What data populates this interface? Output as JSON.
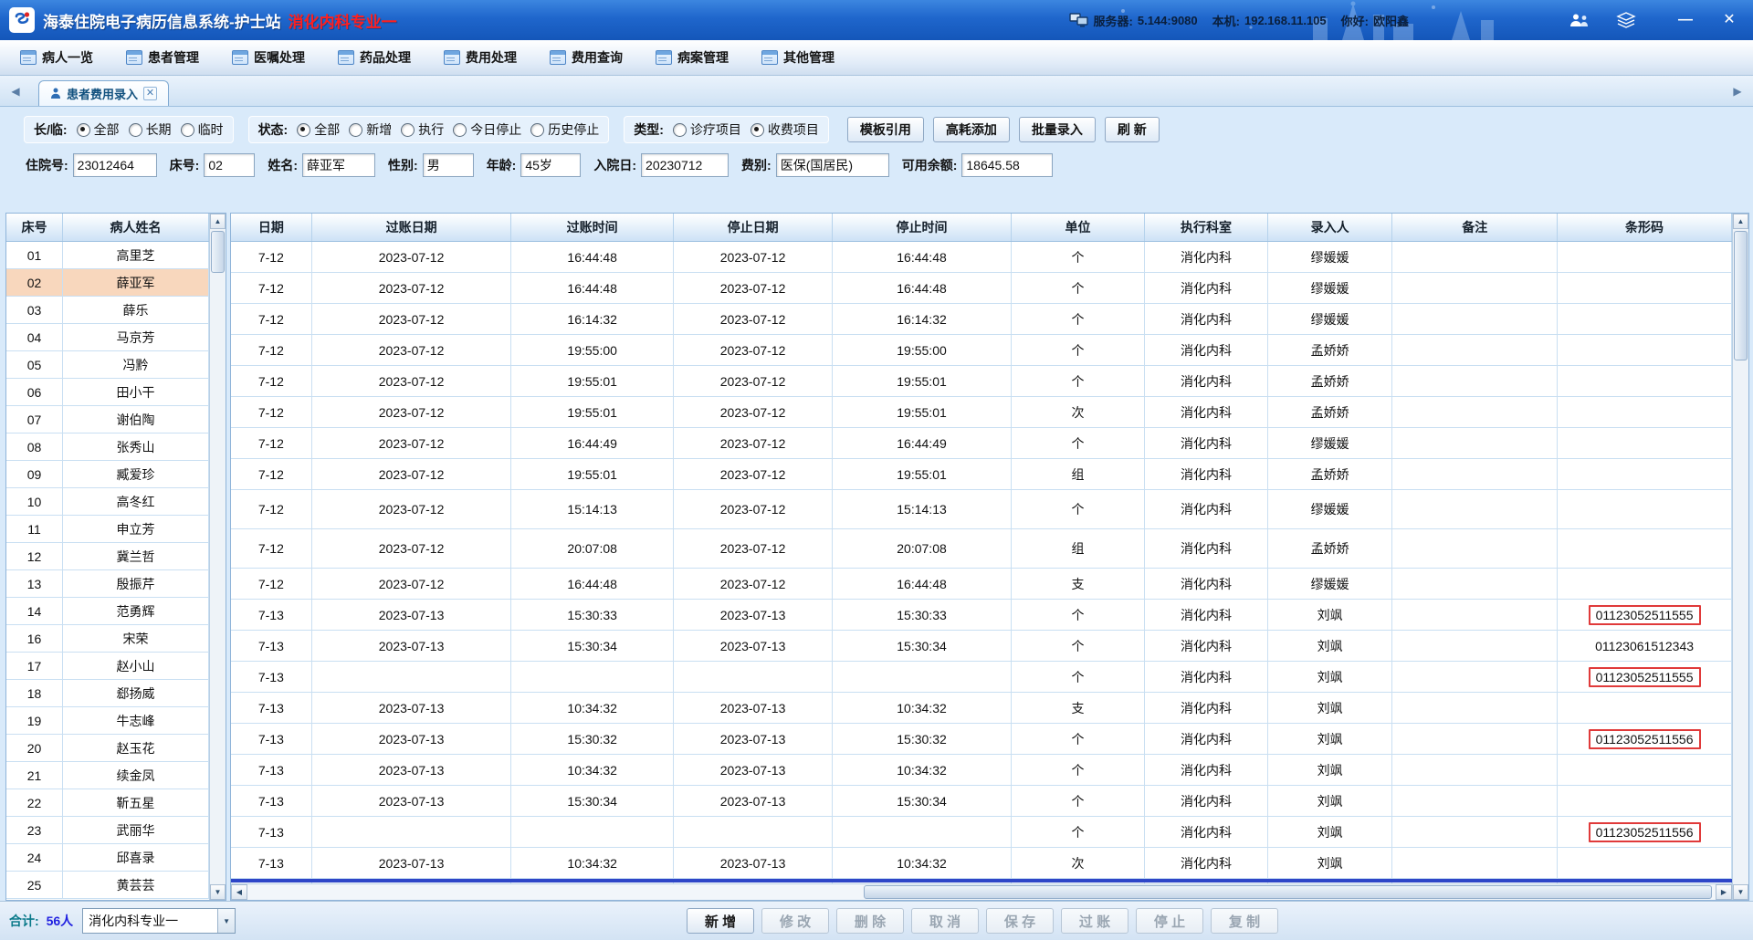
{
  "titlebar": {
    "title": "海泰住院电子病历信息系统-护士站",
    "department": "消化内科专业一",
    "server_label": "服务器:",
    "server_value": "5.144:9080",
    "host_label": "本机:",
    "host_value": "192.168.11.105",
    "greeting_label": "你好:",
    "user_name": "欧阳鑫",
    "minimize_glyph": "—",
    "close_glyph": "✕"
  },
  "menubar": {
    "items": [
      {
        "label": "病人一览"
      },
      {
        "label": "患者管理"
      },
      {
        "label": "医嘱处理"
      },
      {
        "label": "药品处理"
      },
      {
        "label": "费用处理"
      },
      {
        "label": "费用查询"
      },
      {
        "label": "病案管理"
      },
      {
        "label": "其他管理"
      }
    ]
  },
  "tabbar": {
    "active_tab": "患者费用录入",
    "close_glyph": "✕",
    "left_arrow": "◀",
    "right_arrow": "▶"
  },
  "filters": {
    "duration": {
      "label": "长/临:",
      "options": [
        {
          "label": "全部",
          "checked": true
        },
        {
          "label": "长期",
          "checked": false
        },
        {
          "label": "临时",
          "checked": false
        }
      ]
    },
    "status": {
      "label": "状态:",
      "options": [
        {
          "label": "全部",
          "checked": true
        },
        {
          "label": "新增",
          "checked": false
        },
        {
          "label": "执行",
          "checked": false
        },
        {
          "label": "今日停止",
          "checked": false
        },
        {
          "label": "历史停止",
          "checked": false
        }
      ]
    },
    "type": {
      "label": "类型:",
      "options": [
        {
          "label": "诊疗项目",
          "checked": false
        },
        {
          "label": "收费项目",
          "checked": true
        }
      ]
    },
    "buttons": [
      {
        "label": "模板引用"
      },
      {
        "label": "高耗添加"
      },
      {
        "label": "批量录入"
      },
      {
        "label": "刷 新"
      }
    ]
  },
  "patient_info": {
    "fields": [
      {
        "label": "住院号:",
        "value": "23012464"
      },
      {
        "label": "床号:",
        "value": "02"
      },
      {
        "label": "姓名:",
        "value": "薛亚军"
      },
      {
        "label": "性别:",
        "value": "男"
      },
      {
        "label": "年龄:",
        "value": "45岁"
      },
      {
        "label": "入院日:",
        "value": "20230712"
      },
      {
        "label": "费别:",
        "value": "医保(国居民)"
      },
      {
        "label": "可用余额:",
        "value": "18645.58"
      }
    ]
  },
  "patient_list": {
    "headers": {
      "bed": "床号",
      "name": "病人姓名"
    },
    "rows": [
      {
        "bed": "01",
        "name": "高里芝",
        "selected": false
      },
      {
        "bed": "02",
        "name": "薛亚军",
        "selected": true
      },
      {
        "bed": "03",
        "name": "薛乐",
        "selected": false
      },
      {
        "bed": "04",
        "name": "马京芳",
        "selected": false
      },
      {
        "bed": "05",
        "name": "冯黔",
        "selected": false
      },
      {
        "bed": "06",
        "name": "田小干",
        "selected": false
      },
      {
        "bed": "07",
        "name": "谢伯陶",
        "selected": false
      },
      {
        "bed": "08",
        "name": "张秀山",
        "selected": false
      },
      {
        "bed": "09",
        "name": "臧爱珍",
        "selected": false
      },
      {
        "bed": "10",
        "name": "高冬红",
        "selected": false
      },
      {
        "bed": "11",
        "name": "申立芳",
        "selected": false
      },
      {
        "bed": "12",
        "name": "冀兰哲",
        "selected": false
      },
      {
        "bed": "13",
        "name": "殷振芹",
        "selected": false
      },
      {
        "bed": "14",
        "name": "范勇辉",
        "selected": false
      },
      {
        "bed": "16",
        "name": "宋荣",
        "selected": false
      },
      {
        "bed": "17",
        "name": "赵小山",
        "selected": false
      },
      {
        "bed": "18",
        "name": "郄扬威",
        "selected": false
      },
      {
        "bed": "19",
        "name": "牛志峰",
        "selected": false
      },
      {
        "bed": "20",
        "name": "赵玉花",
        "selected": false
      },
      {
        "bed": "21",
        "name": "续金凤",
        "selected": false
      },
      {
        "bed": "22",
        "name": "靳五星",
        "selected": false
      },
      {
        "bed": "23",
        "name": "武丽华",
        "selected": false
      },
      {
        "bed": "24",
        "name": "邱喜录",
        "selected": false
      },
      {
        "bed": "25",
        "name": "黄芸芸",
        "selected": false
      }
    ]
  },
  "fee_table": {
    "headers": [
      "日期",
      "过账日期",
      "过账时间",
      "停止日期",
      "停止时间",
      "单位",
      "执行科室",
      "录入人",
      "备注",
      "条形码"
    ],
    "rows": [
      {
        "date": "7-12",
        "post_date": "2023-07-12",
        "post_time": "16:44:48",
        "stop_date": "2023-07-12",
        "stop_time": "16:44:48",
        "unit": "个",
        "dept": "消化内科",
        "operator": "缪媛媛",
        "note": "",
        "barcode": "",
        "barcode_boxed": false,
        "tall": false
      },
      {
        "date": "7-12",
        "post_date": "2023-07-12",
        "post_time": "16:44:48",
        "stop_date": "2023-07-12",
        "stop_time": "16:44:48",
        "unit": "个",
        "dept": "消化内科",
        "operator": "缪媛媛",
        "note": "",
        "barcode": "",
        "barcode_boxed": false,
        "tall": false
      },
      {
        "date": "7-12",
        "post_date": "2023-07-12",
        "post_time": "16:14:32",
        "stop_date": "2023-07-12",
        "stop_time": "16:14:32",
        "unit": "个",
        "dept": "消化内科",
        "operator": "缪媛媛",
        "note": "",
        "barcode": "",
        "barcode_boxed": false,
        "tall": false
      },
      {
        "date": "7-12",
        "post_date": "2023-07-12",
        "post_time": "19:55:00",
        "stop_date": "2023-07-12",
        "stop_time": "19:55:00",
        "unit": "个",
        "dept": "消化内科",
        "operator": "孟娇娇",
        "note": "",
        "barcode": "",
        "barcode_boxed": false,
        "tall": false
      },
      {
        "date": "7-12",
        "post_date": "2023-07-12",
        "post_time": "19:55:01",
        "stop_date": "2023-07-12",
        "stop_time": "19:55:01",
        "unit": "个",
        "dept": "消化内科",
        "operator": "孟娇娇",
        "note": "",
        "barcode": "",
        "barcode_boxed": false,
        "tall": false
      },
      {
        "date": "7-12",
        "post_date": "2023-07-12",
        "post_time": "19:55:01",
        "stop_date": "2023-07-12",
        "stop_time": "19:55:01",
        "unit": "次",
        "dept": "消化内科",
        "operator": "孟娇娇",
        "note": "",
        "barcode": "",
        "barcode_boxed": false,
        "tall": false
      },
      {
        "date": "7-12",
        "post_date": "2023-07-12",
        "post_time": "16:44:49",
        "stop_date": "2023-07-12",
        "stop_time": "16:44:49",
        "unit": "个",
        "dept": "消化内科",
        "operator": "缪媛媛",
        "note": "",
        "barcode": "",
        "barcode_boxed": false,
        "tall": false
      },
      {
        "date": "7-12",
        "post_date": "2023-07-12",
        "post_time": "19:55:01",
        "stop_date": "2023-07-12",
        "stop_time": "19:55:01",
        "unit": "组",
        "dept": "消化内科",
        "operator": "孟娇娇",
        "note": "",
        "barcode": "",
        "barcode_boxed": false,
        "tall": false
      },
      {
        "date": "7-12",
        "post_date": "2023-07-12",
        "post_time": "15:14:13",
        "stop_date": "2023-07-12",
        "stop_time": "15:14:13",
        "unit": "个",
        "dept": "消化内科",
        "operator": "缪媛媛",
        "note": "",
        "barcode": "",
        "barcode_boxed": false,
        "tall": true
      },
      {
        "date": "7-12",
        "post_date": "2023-07-12",
        "post_time": "20:07:08",
        "stop_date": "2023-07-12",
        "stop_time": "20:07:08",
        "unit": "组",
        "dept": "消化内科",
        "operator": "孟娇娇",
        "note": "",
        "barcode": "",
        "barcode_boxed": false,
        "tall": true
      },
      {
        "date": "7-12",
        "post_date": "2023-07-12",
        "post_time": "16:44:48",
        "stop_date": "2023-07-12",
        "stop_time": "16:44:48",
        "unit": "支",
        "dept": "消化内科",
        "operator": "缪媛媛",
        "note": "",
        "barcode": "",
        "barcode_boxed": false,
        "tall": false
      },
      {
        "date": "7-13",
        "post_date": "2023-07-13",
        "post_time": "15:30:33",
        "stop_date": "2023-07-13",
        "stop_time": "15:30:33",
        "unit": "个",
        "dept": "消化内科",
        "operator": "刘飒",
        "note": "",
        "barcode": "01123052511555",
        "barcode_boxed": true,
        "tall": false
      },
      {
        "date": "7-13",
        "post_date": "2023-07-13",
        "post_time": "15:30:34",
        "stop_date": "2023-07-13",
        "stop_time": "15:30:34",
        "unit": "个",
        "dept": "消化内科",
        "operator": "刘飒",
        "note": "",
        "barcode": "01123061512343",
        "barcode_boxed": false,
        "tall": false
      },
      {
        "date": "7-13",
        "post_date": "",
        "post_time": "",
        "stop_date": "",
        "stop_time": "",
        "unit": "个",
        "dept": "消化内科",
        "operator": "刘飒",
        "note": "",
        "barcode": "01123052511555",
        "barcode_boxed": true,
        "tall": false
      },
      {
        "date": "7-13",
        "post_date": "2023-07-13",
        "post_time": "10:34:32",
        "stop_date": "2023-07-13",
        "stop_time": "10:34:32",
        "unit": "支",
        "dept": "消化内科",
        "operator": "刘飒",
        "note": "",
        "barcode": "",
        "barcode_boxed": false,
        "tall": false
      },
      {
        "date": "7-13",
        "post_date": "2023-07-13",
        "post_time": "15:30:32",
        "stop_date": "2023-07-13",
        "stop_time": "15:30:32",
        "unit": "个",
        "dept": "消化内科",
        "operator": "刘飒",
        "note": "",
        "barcode": "01123052511556",
        "barcode_boxed": true,
        "tall": false
      },
      {
        "date": "7-13",
        "post_date": "2023-07-13",
        "post_time": "10:34:32",
        "stop_date": "2023-07-13",
        "stop_time": "10:34:32",
        "unit": "个",
        "dept": "消化内科",
        "operator": "刘飒",
        "note": "",
        "barcode": "",
        "barcode_boxed": false,
        "tall": false
      },
      {
        "date": "7-13",
        "post_date": "2023-07-13",
        "post_time": "15:30:34",
        "stop_date": "2023-07-13",
        "stop_time": "15:30:34",
        "unit": "个",
        "dept": "消化内科",
        "operator": "刘飒",
        "note": "",
        "barcode": "",
        "barcode_boxed": false,
        "tall": false
      },
      {
        "date": "7-13",
        "post_date": "",
        "post_time": "",
        "stop_date": "",
        "stop_time": "",
        "unit": "个",
        "dept": "消化内科",
        "operator": "刘飒",
        "note": "",
        "barcode": "01123052511556",
        "barcode_boxed": true,
        "tall": false
      },
      {
        "date": "7-13",
        "post_date": "2023-07-13",
        "post_time": "10:34:32",
        "stop_date": "2023-07-13",
        "stop_time": "10:34:32",
        "unit": "次",
        "dept": "消化内科",
        "operator": "刘飒",
        "note": "",
        "barcode": "",
        "barcode_boxed": false,
        "tall": false
      }
    ]
  },
  "footer": {
    "total_label": "合计:",
    "total_value": "56人",
    "department_select": "消化内科专业一",
    "buttons": [
      {
        "label": "新 增",
        "disabled": false
      },
      {
        "label": "修 改",
        "disabled": true
      },
      {
        "label": "删 除",
        "disabled": true
      },
      {
        "label": "取 消",
        "disabled": true
      },
      {
        "label": "保 存",
        "disabled": true
      },
      {
        "label": "过 账",
        "disabled": true
      },
      {
        "label": "停 止",
        "disabled": true
      },
      {
        "label": "复 制",
        "disabled": true
      }
    ]
  }
}
